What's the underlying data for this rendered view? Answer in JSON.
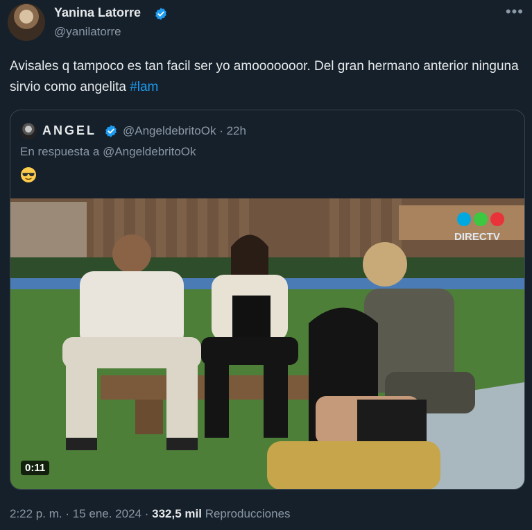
{
  "author": {
    "name": "Yanina Latorre",
    "handle": "@yanilatorre"
  },
  "tweet": {
    "text": "Avisales q tampoco es tan facil ser yo amooooooor. Del gran hermano anterior ninguna sirvio como angelita",
    "hashtag": "#lam"
  },
  "quoted": {
    "name": "ANGEL",
    "handle": "@AngeldebritoOk",
    "time": "22h",
    "reply_to": "En respuesta a @AngeldebritoOk",
    "emoji": "sunglasses-emoji",
    "video": {
      "duration": "0:11",
      "watermark": "DIRECTV"
    }
  },
  "footer": {
    "time": "2:22 p. m.",
    "date": "15 ene. 2024",
    "views": "332,5 mil",
    "views_label": "Reproducciones"
  },
  "colors": {
    "background": "#15202b",
    "text": "#e7e9ea",
    "secondary": "#8b98a5",
    "accent": "#1d9bf0",
    "border": "#38444d"
  }
}
